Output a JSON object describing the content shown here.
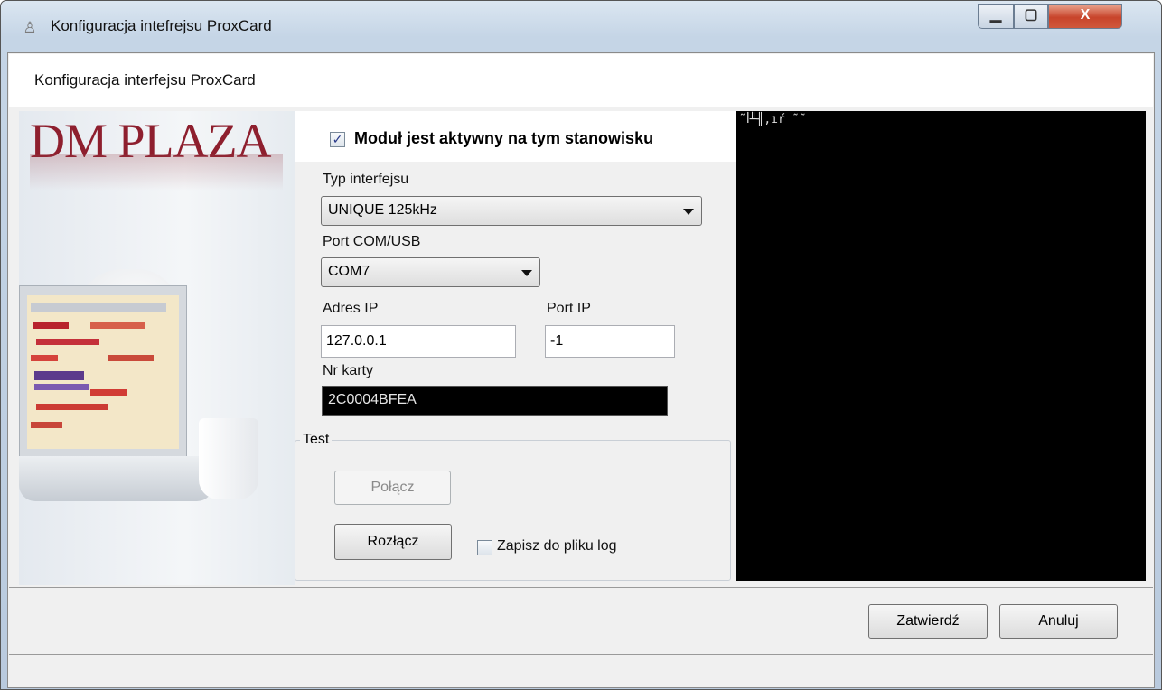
{
  "window": {
    "title": "Konfiguracja intefrejsu ProxCard",
    "icon": "card-reader-icon",
    "controls": {
      "minimize": "▁",
      "maximize": "▢",
      "close": "X"
    }
  },
  "header": {
    "text": "Konfiguracja interfejsu ProxCard"
  },
  "branding": {
    "logo_text": "DM PLAZA",
    "logo_color": "#8e1f2e"
  },
  "module": {
    "active_label": "Moduł jest aktywny na tym stanowisku",
    "active_checked": true,
    "check_mark": "✓"
  },
  "interface": {
    "label": "Typ interfejsu",
    "selected": "UNIQUE 125kHz"
  },
  "port": {
    "label": "Port COM/USB",
    "selected": "COM7"
  },
  "ip": {
    "address_label": "Adres IP",
    "address_value": "127.0.0.1",
    "port_label": "Port IP",
    "port_value": "-1"
  },
  "card": {
    "label": "Nr karty",
    "value": "2C0004BFEA"
  },
  "test": {
    "legend": "Test",
    "connect_label": "Połącz",
    "connect_enabled": false,
    "disconnect_label": "Rozłącz",
    "log_label": "Zapisz do pliku log",
    "log_checked": false
  },
  "terminal": {
    "text": "˜ꟾ╨╢,ıŕ ˜˜"
  },
  "footer": {
    "ok_label": "Zatwierdź",
    "cancel_label": "Anuluj"
  }
}
